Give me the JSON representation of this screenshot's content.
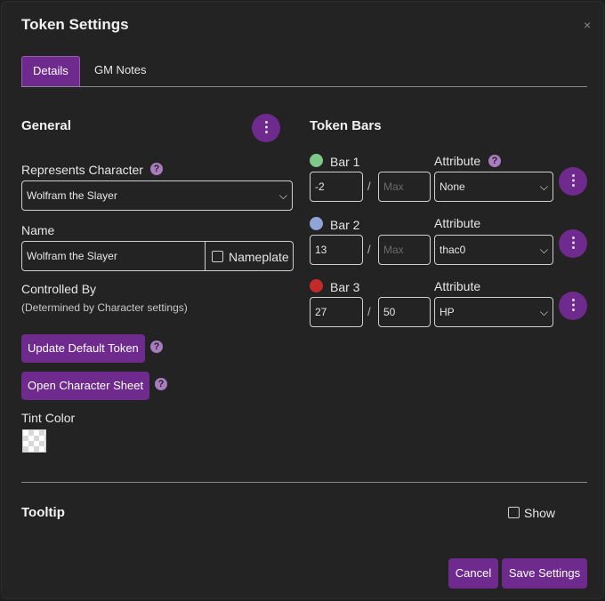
{
  "dialog": {
    "title": "Token Settings",
    "close_icon": "×"
  },
  "tabs": [
    {
      "label": "Details"
    },
    {
      "label": "GM Notes"
    }
  ],
  "general": {
    "heading": "General",
    "represents_label": "Represents Character",
    "represents_value": "Wolfram the Slayer",
    "name_label": "Name",
    "name_value": "Wolfram the Slayer",
    "nameplate_label": "Nameplate",
    "controlled_label": "Controlled By",
    "controlled_sub": "(Determined by Character settings)",
    "update_button": "Update Default Token",
    "open_sheet_button": "Open Character Sheet",
    "tint_label": "Tint Color"
  },
  "token_bars": {
    "heading": "Token Bars",
    "attribute_label": "Attribute",
    "bars": [
      {
        "label": "Bar 1",
        "color": "#7ec98a",
        "value": "-2",
        "max": "",
        "max_placeholder": "Max",
        "attribute": "None"
      },
      {
        "label": "Bar 2",
        "color": "#8fa5d8",
        "value": "13",
        "max": "",
        "max_placeholder": "Max",
        "attribute": "thac0"
      },
      {
        "label": "Bar 3",
        "color": "#c52a2a",
        "value": "27",
        "max": "50",
        "max_placeholder": "Max",
        "attribute": "HP"
      }
    ]
  },
  "tooltip": {
    "heading": "Tooltip",
    "show_label": "Show"
  },
  "footer": {
    "cancel": "Cancel",
    "save": "Save Settings"
  },
  "help_glyph": "?",
  "slash": "/",
  "accent": "#6e2a8c"
}
